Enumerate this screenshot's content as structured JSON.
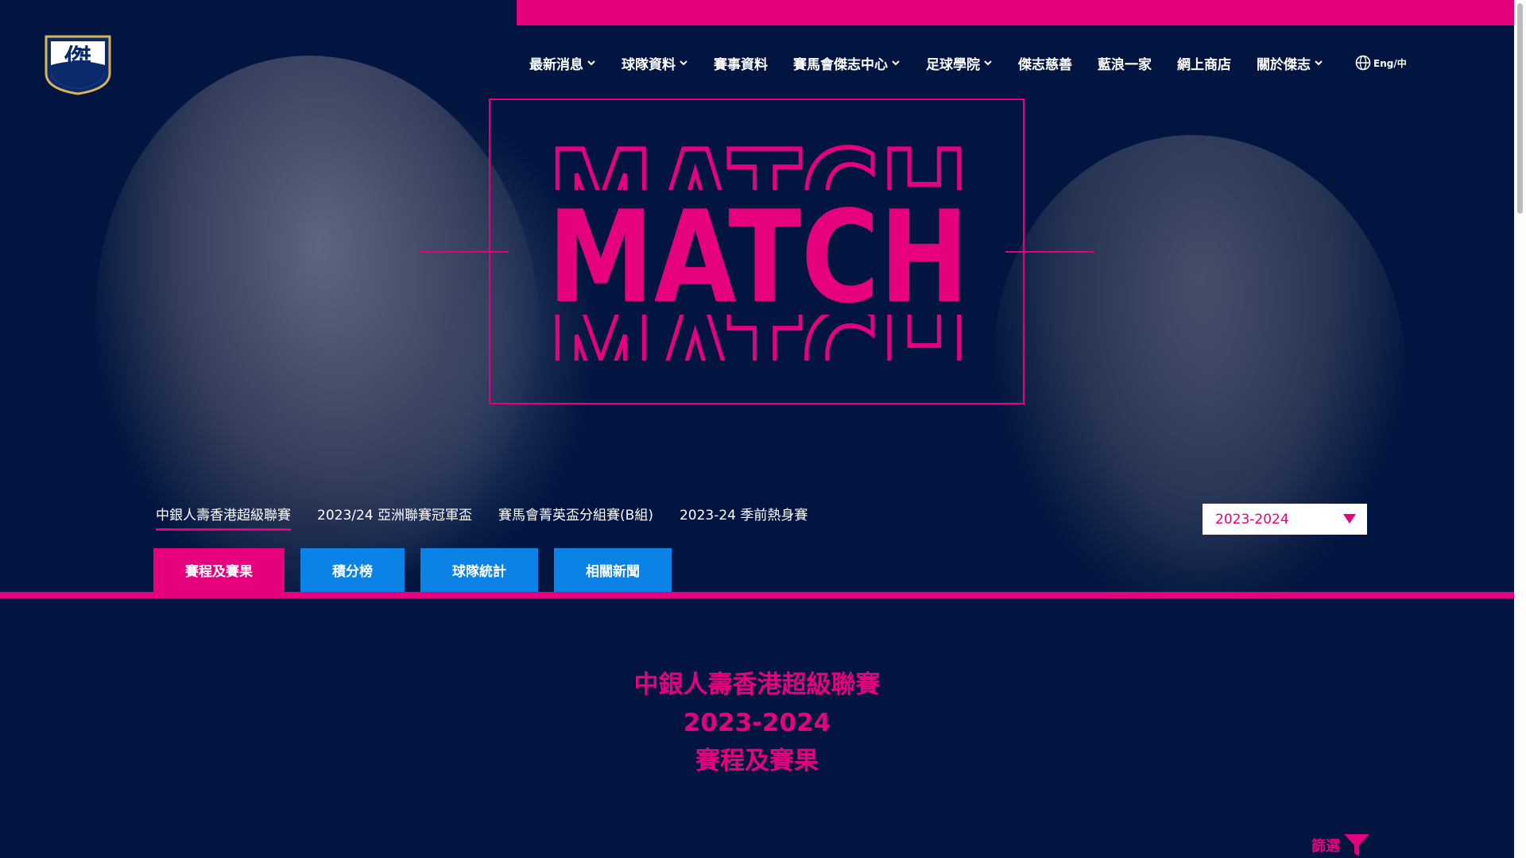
{
  "brand": {
    "logo_text": "傑"
  },
  "nav": {
    "items": [
      {
        "label": "最新消息",
        "dropdown": true
      },
      {
        "label": "球隊資料",
        "dropdown": true
      },
      {
        "label": "賽事資料",
        "dropdown": false
      },
      {
        "label": "賽馬會傑志中心",
        "dropdown": true
      },
      {
        "label": "足球學院",
        "dropdown": true
      },
      {
        "label": "傑志慈善",
        "dropdown": false
      },
      {
        "label": "藍浪一家",
        "dropdown": false
      },
      {
        "label": "網上商店",
        "dropdown": false
      },
      {
        "label": "關於傑志",
        "dropdown": true
      }
    ],
    "language": "Eng/中"
  },
  "hero": {
    "title_top": "MATCH",
    "title_main": "MATCH",
    "title_bottom": "MATCH"
  },
  "competitions": {
    "tabs": [
      {
        "label": "中銀人壽香港超級聯賽",
        "active": true
      },
      {
        "label": "2023/24 亞洲聯賽冠軍盃",
        "active": false
      },
      {
        "label": "賽馬會菁英盃分組賽(B組)",
        "active": false
      },
      {
        "label": "2023-24 季前熱身賽",
        "active": false
      }
    ]
  },
  "season_select": {
    "value": "2023-2024"
  },
  "section_tabs": [
    {
      "label": "賽程及賽果",
      "active": true
    },
    {
      "label": "積分榜",
      "active": false
    },
    {
      "label": "球隊統計",
      "active": false
    },
    {
      "label": "相關新聞",
      "active": false
    }
  ],
  "content": {
    "league": "中銀人壽香港超級聯賽",
    "season": "2023-2024",
    "section": "賽程及賽果"
  },
  "filter": {
    "label": "篩選"
  },
  "colors": {
    "navy": "#021540",
    "pink": "#e6007e",
    "blue": "#0a82e6"
  }
}
